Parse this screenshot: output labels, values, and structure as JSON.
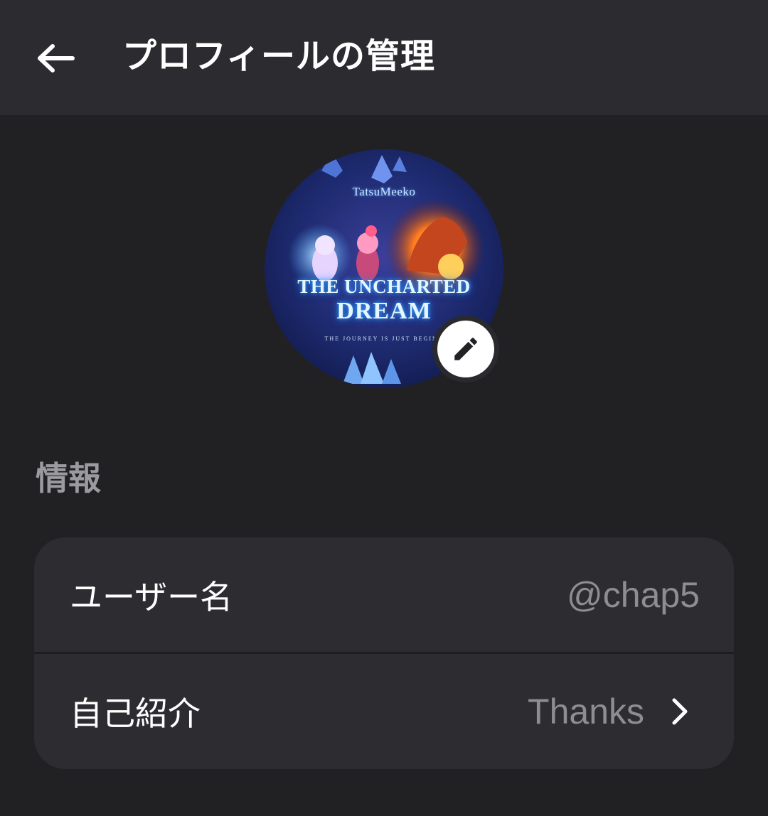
{
  "header": {
    "back_icon": "arrow-left-icon",
    "title": "プロフィールの管理"
  },
  "avatar": {
    "brand_text": "TatsuMeeko",
    "title_line1": "THE UNCHARTED",
    "title_line2": "DREAM",
    "tagline": "THE JOURNEY IS JUST BEGINN",
    "edit_icon": "pencil-icon"
  },
  "section": {
    "label": "情報"
  },
  "rows": [
    {
      "label": "ユーザー名",
      "value": "@chap5"
    },
    {
      "label": "自己紹介",
      "value": "Thanks",
      "chevron_icon": "chevron-right-icon"
    }
  ],
  "colors": {
    "background": "#212123",
    "appbar": "#2b2b30",
    "card": "#2c2c31",
    "text_primary": "#ffffff",
    "text_secondary": "#8d8d92"
  }
}
